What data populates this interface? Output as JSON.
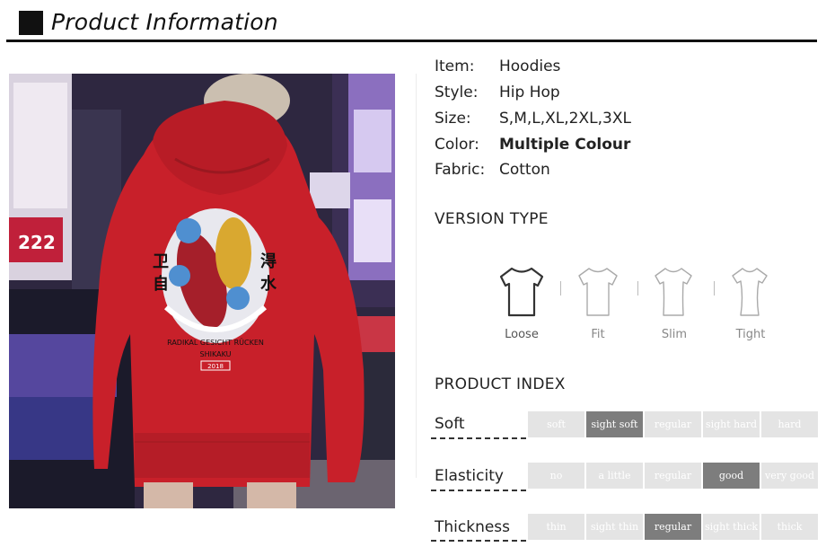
{
  "header": {
    "title": "Product Information"
  },
  "specs": [
    {
      "key": "Item:",
      "value": "Hoodies",
      "bold": false
    },
    {
      "key": "Style:",
      "value": "Hip Hop",
      "bold": false
    },
    {
      "key": "Size:",
      "value": "S,M,L,XL,2XL,3XL",
      "bold": false
    },
    {
      "key": "Color:",
      "value": "Multiple Colour",
      "bold": true
    },
    {
      "key": "Fabric:",
      "value": "Cotton",
      "bold": false
    }
  ],
  "version_type": {
    "title": "VERSION TYPE",
    "items": [
      {
        "label": "Loose",
        "selected": true
      },
      {
        "label": "Fit",
        "selected": false
      },
      {
        "label": "Slim",
        "selected": false
      },
      {
        "label": "Tight",
        "selected": false
      }
    ]
  },
  "product_index": {
    "title": "PRODUCT INDEX",
    "rows": [
      {
        "label": "Soft",
        "options": [
          "soft",
          "sight soft",
          "regular",
          "sight hard",
          "hard"
        ],
        "selected": 1
      },
      {
        "label": "Elasticity",
        "options": [
          "no",
          "a  little",
          "regular",
          "good",
          "very good"
        ],
        "selected": 3
      },
      {
        "label": "Thickness",
        "options": [
          "thin",
          "sight thin",
          "regular",
          "sight thick",
          "thick"
        ],
        "selected": 2
      }
    ]
  },
  "photo": {
    "subject": "red-hoodie-back-koi-print",
    "caption_lines": [
      "RADIKAL GESICHT RÜCKEN",
      "SHIKAKU",
      "2018"
    ]
  },
  "colors": {
    "hoodie": "#c8202a",
    "active_cell": "#7d7d7d",
    "inactive_cell": "#e4e4e4"
  }
}
